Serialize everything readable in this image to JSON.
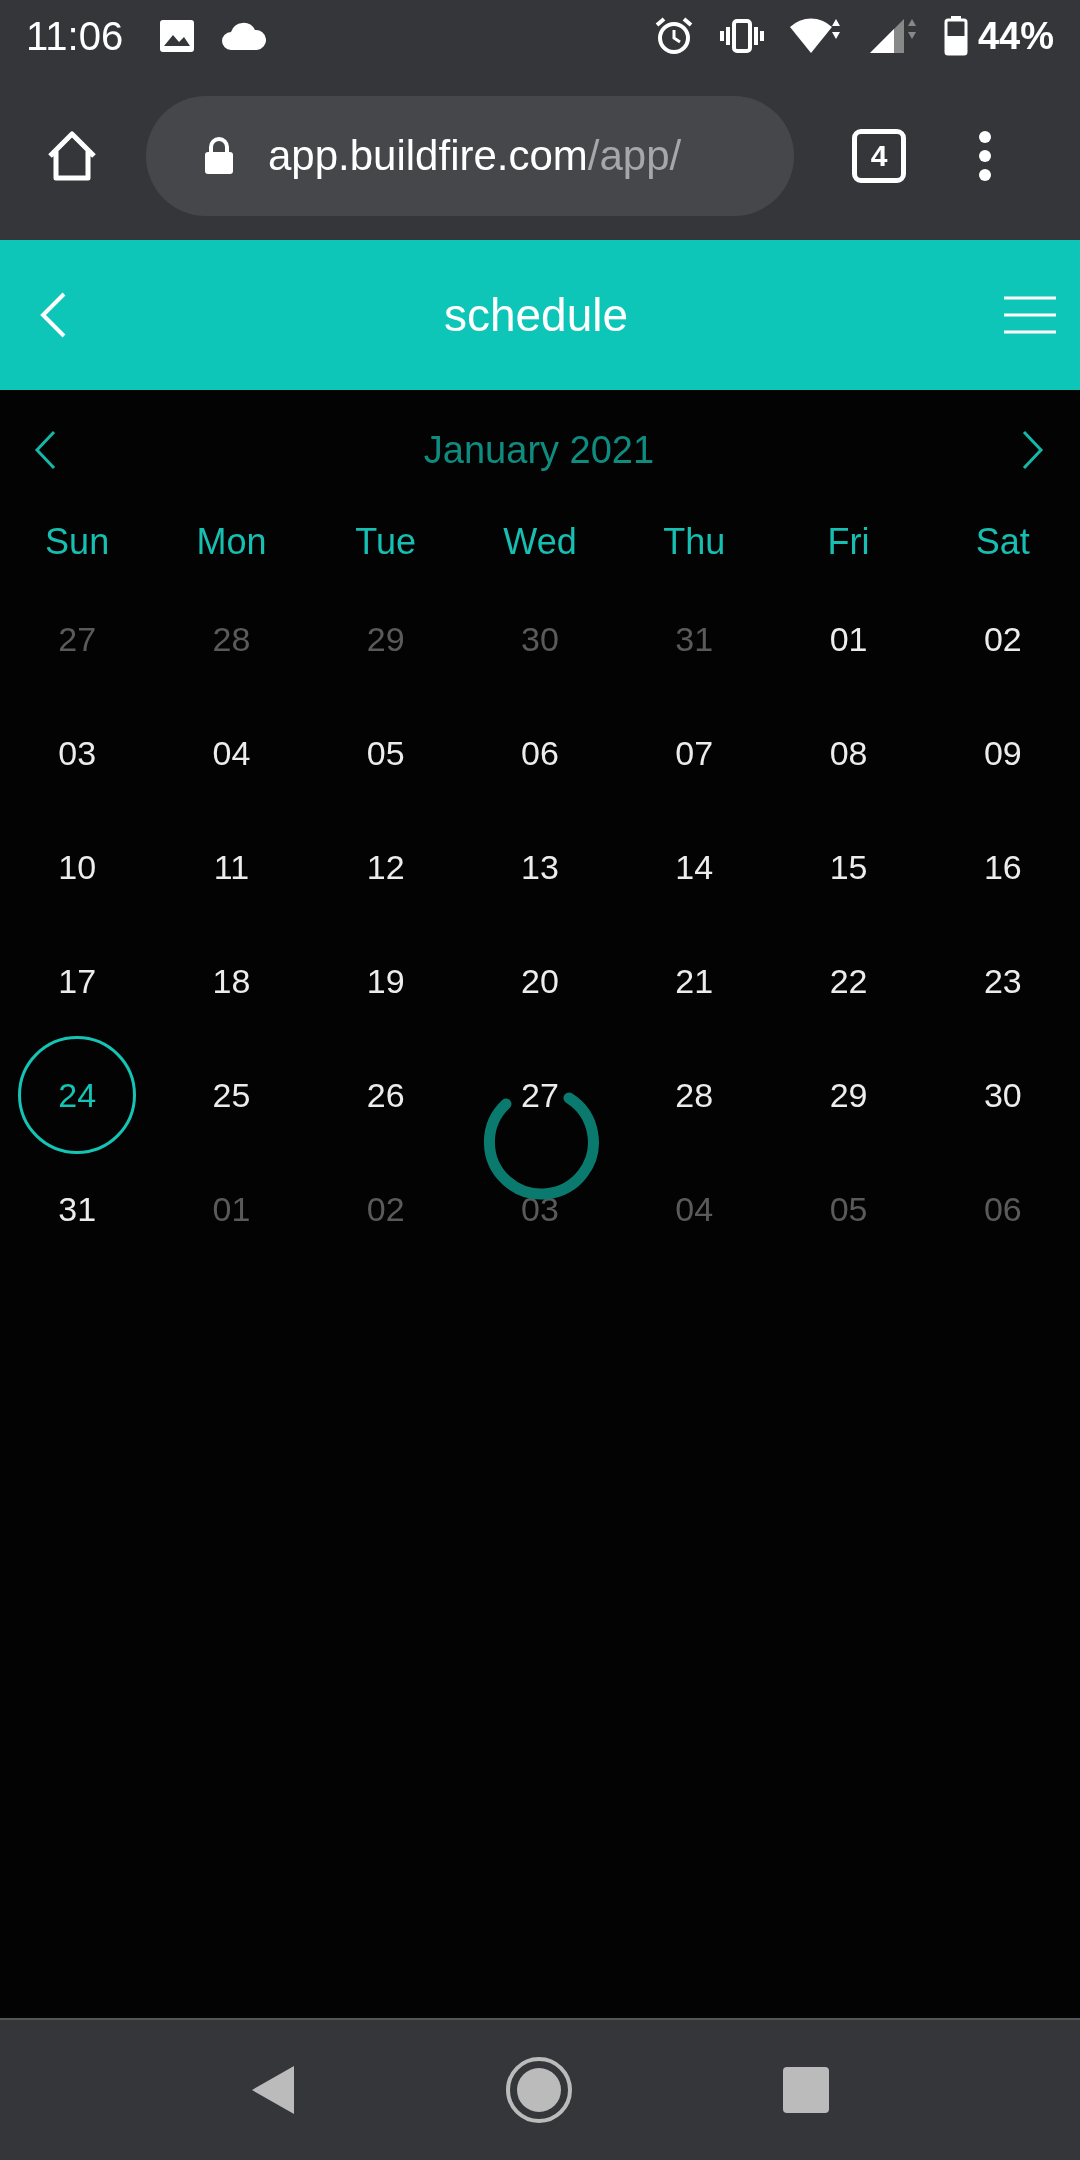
{
  "status_bar": {
    "time": "11:06",
    "battery": "44%"
  },
  "browser": {
    "url_host": "app.buildfire.com",
    "url_path": "/app/",
    "tab_count": "4"
  },
  "header": {
    "title": "schedule"
  },
  "calendar": {
    "month": "January 2021",
    "weekdays": [
      "Sun",
      "Mon",
      "Tue",
      "Wed",
      "Thu",
      "Fri",
      "Sat"
    ],
    "weeks": [
      [
        {
          "day": "27",
          "outside": true,
          "selected": false
        },
        {
          "day": "28",
          "outside": true,
          "selected": false
        },
        {
          "day": "29",
          "outside": true,
          "selected": false
        },
        {
          "day": "30",
          "outside": true,
          "selected": false
        },
        {
          "day": "31",
          "outside": true,
          "selected": false
        },
        {
          "day": "01",
          "outside": false,
          "selected": false
        },
        {
          "day": "02",
          "outside": false,
          "selected": false
        }
      ],
      [
        {
          "day": "03",
          "outside": false,
          "selected": false
        },
        {
          "day": "04",
          "outside": false,
          "selected": false
        },
        {
          "day": "05",
          "outside": false,
          "selected": false
        },
        {
          "day": "06",
          "outside": false,
          "selected": false
        },
        {
          "day": "07",
          "outside": false,
          "selected": false
        },
        {
          "day": "08",
          "outside": false,
          "selected": false
        },
        {
          "day": "09",
          "outside": false,
          "selected": false
        }
      ],
      [
        {
          "day": "10",
          "outside": false,
          "selected": false
        },
        {
          "day": "11",
          "outside": false,
          "selected": false
        },
        {
          "day": "12",
          "outside": false,
          "selected": false
        },
        {
          "day": "13",
          "outside": false,
          "selected": false
        },
        {
          "day": "14",
          "outside": false,
          "selected": false
        },
        {
          "day": "15",
          "outside": false,
          "selected": false
        },
        {
          "day": "16",
          "outside": false,
          "selected": false
        }
      ],
      [
        {
          "day": "17",
          "outside": false,
          "selected": false
        },
        {
          "day": "18",
          "outside": false,
          "selected": false
        },
        {
          "day": "19",
          "outside": false,
          "selected": false
        },
        {
          "day": "20",
          "outside": false,
          "selected": false
        },
        {
          "day": "21",
          "outside": false,
          "selected": false
        },
        {
          "day": "22",
          "outside": false,
          "selected": false
        },
        {
          "day": "23",
          "outside": false,
          "selected": false
        }
      ],
      [
        {
          "day": "24",
          "outside": false,
          "selected": true
        },
        {
          "day": "25",
          "outside": false,
          "selected": false
        },
        {
          "day": "26",
          "outside": false,
          "selected": false
        },
        {
          "day": "27",
          "outside": false,
          "selected": false
        },
        {
          "day": "28",
          "outside": false,
          "selected": false
        },
        {
          "day": "29",
          "outside": false,
          "selected": false
        },
        {
          "day": "30",
          "outside": false,
          "selected": false
        }
      ],
      [
        {
          "day": "31",
          "outside": false,
          "selected": false
        },
        {
          "day": "01",
          "outside": true,
          "selected": false
        },
        {
          "day": "02",
          "outside": true,
          "selected": false
        },
        {
          "day": "03",
          "outside": true,
          "selected": false
        },
        {
          "day": "04",
          "outside": true,
          "selected": false
        },
        {
          "day": "05",
          "outside": true,
          "selected": false
        },
        {
          "day": "06",
          "outside": true,
          "selected": false
        }
      ]
    ],
    "loading": true
  }
}
